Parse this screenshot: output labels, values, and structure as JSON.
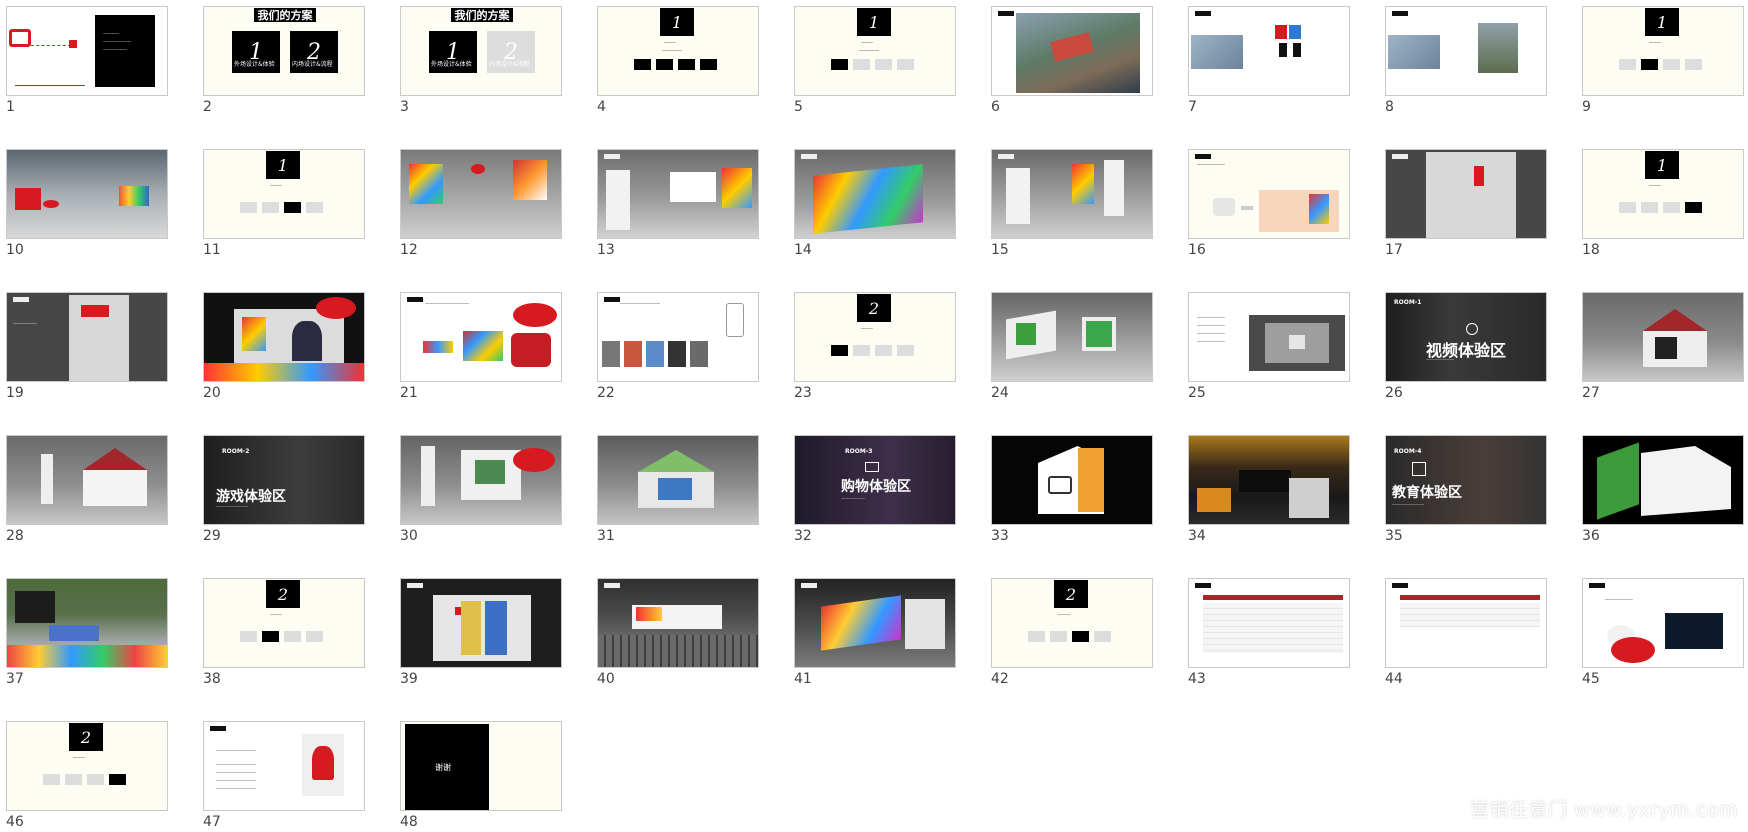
{
  "slides": [
    {
      "n": "1"
    },
    {
      "n": "2"
    },
    {
      "n": "3"
    },
    {
      "n": "4"
    },
    {
      "n": "5"
    },
    {
      "n": "6"
    },
    {
      "n": "7"
    },
    {
      "n": "8"
    },
    {
      "n": "9"
    },
    {
      "n": "10"
    },
    {
      "n": "11"
    },
    {
      "n": "12"
    },
    {
      "n": "13"
    },
    {
      "n": "14"
    },
    {
      "n": "15"
    },
    {
      "n": "16"
    },
    {
      "n": "17"
    },
    {
      "n": "18"
    },
    {
      "n": "19"
    },
    {
      "n": "20"
    },
    {
      "n": "21"
    },
    {
      "n": "22"
    },
    {
      "n": "23"
    },
    {
      "n": "24"
    },
    {
      "n": "25"
    },
    {
      "n": "26"
    },
    {
      "n": "27"
    },
    {
      "n": "28"
    },
    {
      "n": "29"
    },
    {
      "n": "30"
    },
    {
      "n": "31"
    },
    {
      "n": "32"
    },
    {
      "n": "33"
    },
    {
      "n": "34"
    },
    {
      "n": "35"
    },
    {
      "n": "36"
    },
    {
      "n": "37"
    },
    {
      "n": "38"
    },
    {
      "n": "39"
    },
    {
      "n": "40"
    },
    {
      "n": "41"
    },
    {
      "n": "42"
    },
    {
      "n": "43"
    },
    {
      "n": "44"
    },
    {
      "n": "45"
    },
    {
      "n": "46"
    },
    {
      "n": "47"
    },
    {
      "n": "48"
    }
  ],
  "text": {
    "plan_title": "我们的方案",
    "one": "1",
    "two": "2",
    "exterior": "外场设计&体验",
    "interior": "内场设计&流程",
    "room1": "ROOM-1",
    "room2": "ROOM-2",
    "room3": "ROOM-3",
    "room4": "ROOM-4",
    "video_zone": "视频体验区",
    "game_zone": "游戏体验区",
    "shop_zone": "购物体验区",
    "edu_zone": "教育体验区",
    "thanks": "谢谢",
    "watermark": "营销任意门 www.yxrym.com"
  },
  "colors": {
    "accent_red": "#d71920",
    "slide_cream": "#fdfdf4"
  }
}
